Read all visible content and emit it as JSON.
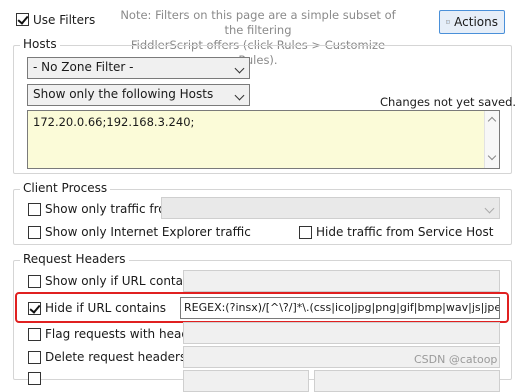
{
  "top": {
    "use_filters_label": "Use Filters",
    "use_filters_checked": true,
    "note_line1": "Note: Filters on this page are a simple subset of the filtering",
    "note_line2": "FiddlerScript offers (click Rules > Customize Rules).",
    "actions_label": "Actions"
  },
  "hosts": {
    "title": "Hosts",
    "zone_filter": "- No Zone Filter -",
    "host_filter": "Show only the following Hosts",
    "status": "Changes not yet saved.",
    "host_list": "172.20.0.66;192.168.3.240;"
  },
  "client_process": {
    "title": "Client Process",
    "show_only_traffic_from_label": "Show only traffic from",
    "show_only_ie_label": "Show only Internet Explorer traffic",
    "hide_service_host_label": "Hide traffic from Service Host"
  },
  "request_headers": {
    "title": "Request Headers",
    "show_only_url_label": "Show only if URL contains",
    "hide_url_label": "Hide if URL contains",
    "hide_url_checked": true,
    "hide_url_value": "REGEX:(?insx)/[^\\?/]*\\.(css|ico|jpg|png|gif|bmp|wav|js|jpeg)(\\?",
    "flag_headers_label": "Flag requests with headers",
    "delete_headers_label": "Delete request headers"
  },
  "watermark": "CSDN @catoop",
  "colors": {
    "highlight": "#e02020",
    "host_list_bg": "#fbfbd8",
    "accent": "#4a90d9"
  }
}
